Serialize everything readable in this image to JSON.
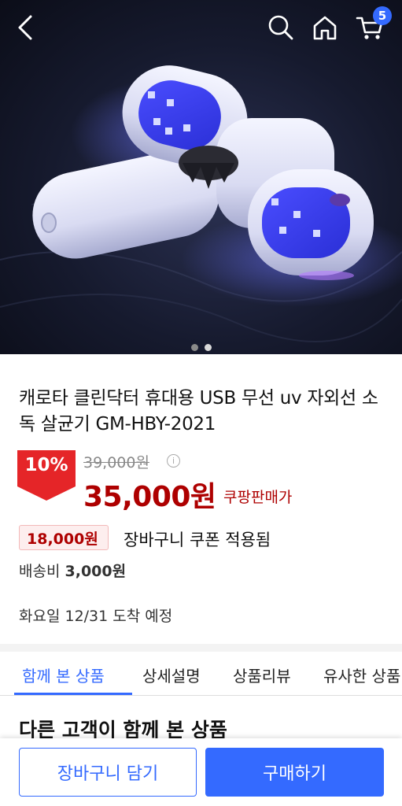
{
  "header": {
    "cart_count": "5",
    "icons": [
      "back-arrow-icon",
      "search-icon",
      "home-icon",
      "cart-icon"
    ]
  },
  "gallery": {
    "total_images": 2,
    "active_index": 1
  },
  "product": {
    "title": "캐로타 클린닥터 휴대용 USB 무선 uv 자외선 소독 살균기 GM-HBY-2021",
    "discount": "10%",
    "original_price": "39,000원",
    "sale_price": "35,000원",
    "sale_label": "쿠팡판매가",
    "coupon_price": "18,000원",
    "coupon_text": "장바구니 쿠폰 적용됨",
    "shipping_label": "배송비",
    "shipping_fee": "3,000원",
    "delivery": "화요일 12/31 도착 예정"
  },
  "tabs": [
    {
      "label": "함께 본 상품",
      "active": true
    },
    {
      "label": "상세설명",
      "active": false
    },
    {
      "label": "상품리뷰",
      "active": false
    },
    {
      "label": "유사한 상품",
      "active": false
    }
  ],
  "section": {
    "title": "다른 고객이 함께 본 상품"
  },
  "actions": {
    "add_to_cart": "장바구니 담기",
    "buy_now": "구매하기"
  },
  "colors": {
    "accent": "#346aff",
    "price_red": "#ae0000",
    "discount_red": "#e52528"
  }
}
